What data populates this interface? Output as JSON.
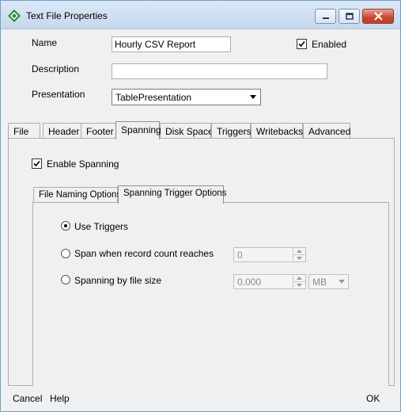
{
  "window": {
    "title": "Text File Properties",
    "icon": "green-diamond-app-icon",
    "controls": {
      "minimize": "minimize-icon",
      "maximize": "maximize-icon",
      "close": "close-icon"
    }
  },
  "form": {
    "name_label": "Name",
    "name_value": "Hourly CSV Report",
    "enabled_label": "Enabled",
    "enabled_checked": true,
    "description_label": "Description",
    "description_value": "",
    "presentation_label": "Presentation",
    "presentation_value": "TablePresentation"
  },
  "tabs": [
    {
      "label": "File",
      "active": false
    },
    {
      "label": "Header",
      "active": false
    },
    {
      "label": "Footer",
      "active": false
    },
    {
      "label": "Spanning",
      "active": true
    },
    {
      "label": "Disk Space",
      "active": false
    },
    {
      "label": "Triggers",
      "active": false
    },
    {
      "label": "Writebacks",
      "active": false
    },
    {
      "label": "Advanced",
      "active": false
    }
  ],
  "spanning": {
    "enable_label": "Enable Spanning",
    "enable_checked": true,
    "inner_tabs": [
      {
        "label": "File Naming Options",
        "active": false
      },
      {
        "label": "Spanning Trigger Options",
        "active": true
      }
    ],
    "options": {
      "use_triggers": {
        "label": "Use Triggers",
        "selected": true
      },
      "record_count": {
        "label": "Span when record count reaches",
        "selected": false,
        "value": "0"
      },
      "file_size": {
        "label": "Spanning by file size",
        "selected": false,
        "value": "0.000",
        "unit": "MB"
      }
    }
  },
  "footer": {
    "cancel_label": "Cancel",
    "help_label": "Help",
    "ok_label": "OK"
  },
  "colors": {
    "title_bar": "#c7d9ee",
    "close_button": "#c7452f",
    "window_bg": "#f0f0f0"
  }
}
